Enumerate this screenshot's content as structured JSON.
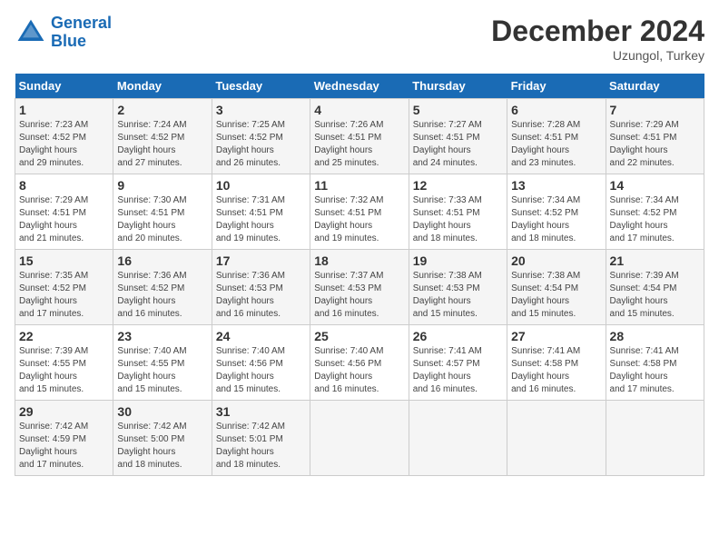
{
  "logo": {
    "line1": "General",
    "line2": "Blue"
  },
  "title": "December 2024",
  "subtitle": "Uzungol, Turkey",
  "days_of_week": [
    "Sunday",
    "Monday",
    "Tuesday",
    "Wednesday",
    "Thursday",
    "Friday",
    "Saturday"
  ],
  "weeks": [
    [
      {
        "day": "1",
        "sunrise": "7:23 AM",
        "sunset": "4:52 PM",
        "daylight": "9 hours and 29 minutes."
      },
      {
        "day": "2",
        "sunrise": "7:24 AM",
        "sunset": "4:52 PM",
        "daylight": "9 hours and 27 minutes."
      },
      {
        "day": "3",
        "sunrise": "7:25 AM",
        "sunset": "4:52 PM",
        "daylight": "9 hours and 26 minutes."
      },
      {
        "day": "4",
        "sunrise": "7:26 AM",
        "sunset": "4:51 PM",
        "daylight": "9 hours and 25 minutes."
      },
      {
        "day": "5",
        "sunrise": "7:27 AM",
        "sunset": "4:51 PM",
        "daylight": "9 hours and 24 minutes."
      },
      {
        "day": "6",
        "sunrise": "7:28 AM",
        "sunset": "4:51 PM",
        "daylight": "9 hours and 23 minutes."
      },
      {
        "day": "7",
        "sunrise": "7:29 AM",
        "sunset": "4:51 PM",
        "daylight": "9 hours and 22 minutes."
      }
    ],
    [
      {
        "day": "8",
        "sunrise": "7:29 AM",
        "sunset": "4:51 PM",
        "daylight": "9 hours and 21 minutes."
      },
      {
        "day": "9",
        "sunrise": "7:30 AM",
        "sunset": "4:51 PM",
        "daylight": "9 hours and 20 minutes."
      },
      {
        "day": "10",
        "sunrise": "7:31 AM",
        "sunset": "4:51 PM",
        "daylight": "9 hours and 19 minutes."
      },
      {
        "day": "11",
        "sunrise": "7:32 AM",
        "sunset": "4:51 PM",
        "daylight": "9 hours and 19 minutes."
      },
      {
        "day": "12",
        "sunrise": "7:33 AM",
        "sunset": "4:51 PM",
        "daylight": "9 hours and 18 minutes."
      },
      {
        "day": "13",
        "sunrise": "7:34 AM",
        "sunset": "4:52 PM",
        "daylight": "9 hours and 18 minutes."
      },
      {
        "day": "14",
        "sunrise": "7:34 AM",
        "sunset": "4:52 PM",
        "daylight": "9 hours and 17 minutes."
      }
    ],
    [
      {
        "day": "15",
        "sunrise": "7:35 AM",
        "sunset": "4:52 PM",
        "daylight": "9 hours and 17 minutes."
      },
      {
        "day": "16",
        "sunrise": "7:36 AM",
        "sunset": "4:52 PM",
        "daylight": "9 hours and 16 minutes."
      },
      {
        "day": "17",
        "sunrise": "7:36 AM",
        "sunset": "4:53 PM",
        "daylight": "9 hours and 16 minutes."
      },
      {
        "day": "18",
        "sunrise": "7:37 AM",
        "sunset": "4:53 PM",
        "daylight": "9 hours and 16 minutes."
      },
      {
        "day": "19",
        "sunrise": "7:38 AM",
        "sunset": "4:53 PM",
        "daylight": "9 hours and 15 minutes."
      },
      {
        "day": "20",
        "sunrise": "7:38 AM",
        "sunset": "4:54 PM",
        "daylight": "9 hours and 15 minutes."
      },
      {
        "day": "21",
        "sunrise": "7:39 AM",
        "sunset": "4:54 PM",
        "daylight": "9 hours and 15 minutes."
      }
    ],
    [
      {
        "day": "22",
        "sunrise": "7:39 AM",
        "sunset": "4:55 PM",
        "daylight": "9 hours and 15 minutes."
      },
      {
        "day": "23",
        "sunrise": "7:40 AM",
        "sunset": "4:55 PM",
        "daylight": "9 hours and 15 minutes."
      },
      {
        "day": "24",
        "sunrise": "7:40 AM",
        "sunset": "4:56 PM",
        "daylight": "9 hours and 15 minutes."
      },
      {
        "day": "25",
        "sunrise": "7:40 AM",
        "sunset": "4:56 PM",
        "daylight": "9 hours and 16 minutes."
      },
      {
        "day": "26",
        "sunrise": "7:41 AM",
        "sunset": "4:57 PM",
        "daylight": "9 hours and 16 minutes."
      },
      {
        "day": "27",
        "sunrise": "7:41 AM",
        "sunset": "4:58 PM",
        "daylight": "9 hours and 16 minutes."
      },
      {
        "day": "28",
        "sunrise": "7:41 AM",
        "sunset": "4:58 PM",
        "daylight": "9 hours and 17 minutes."
      }
    ],
    [
      {
        "day": "29",
        "sunrise": "7:42 AM",
        "sunset": "4:59 PM",
        "daylight": "9 hours and 17 minutes."
      },
      {
        "day": "30",
        "sunrise": "7:42 AM",
        "sunset": "5:00 PM",
        "daylight": "9 hours and 18 minutes."
      },
      {
        "day": "31",
        "sunrise": "7:42 AM",
        "sunset": "5:01 PM",
        "daylight": "9 hours and 18 minutes."
      },
      null,
      null,
      null,
      null
    ]
  ]
}
